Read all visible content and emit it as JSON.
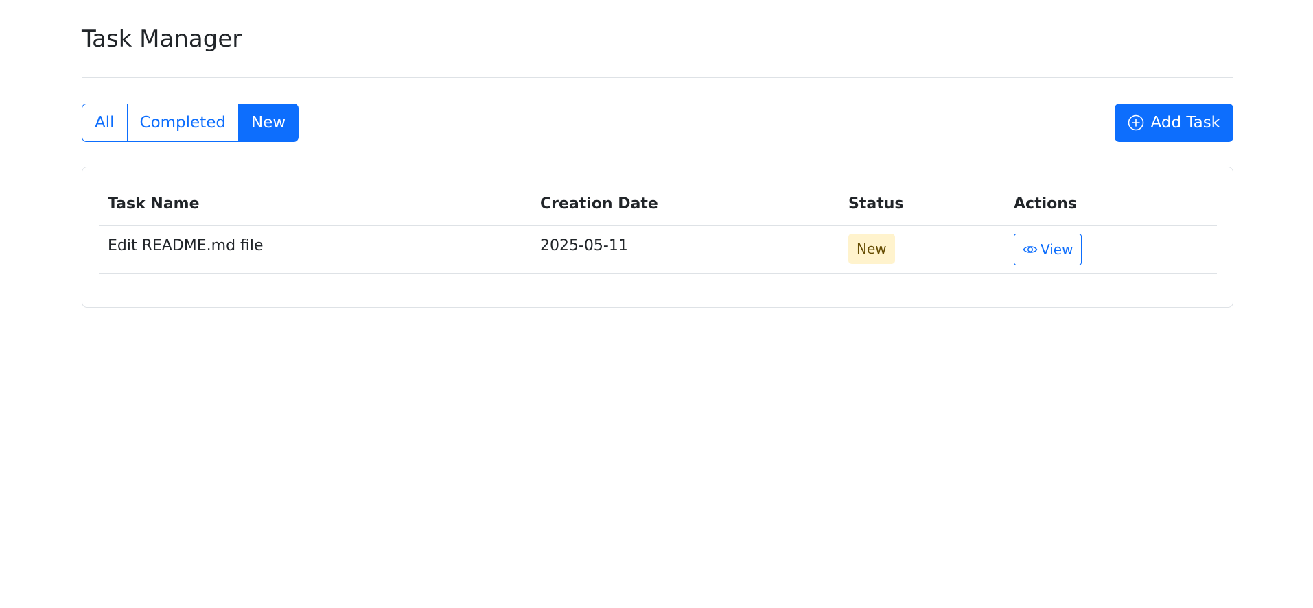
{
  "app": {
    "title": "Task Manager"
  },
  "filters": {
    "items": [
      {
        "label": "All",
        "active": false
      },
      {
        "label": "Completed",
        "active": false
      },
      {
        "label": "New",
        "active": true
      }
    ]
  },
  "toolbar": {
    "add_label": "Add Task",
    "add_icon": "plus-circle-icon"
  },
  "table": {
    "headers": [
      "Task Name",
      "Creation Date",
      "Status",
      "Actions"
    ],
    "rows": [
      {
        "name": "Edit README.md file",
        "date": "2025-05-11",
        "status": "New",
        "action_label": "View",
        "action_icon": "eye-icon"
      }
    ]
  },
  "colors": {
    "primary": "#0d6efd",
    "badge_bg": "#fff3cd",
    "badge_text": "#664d03",
    "border": "#dee2e6",
    "text": "#212529"
  }
}
